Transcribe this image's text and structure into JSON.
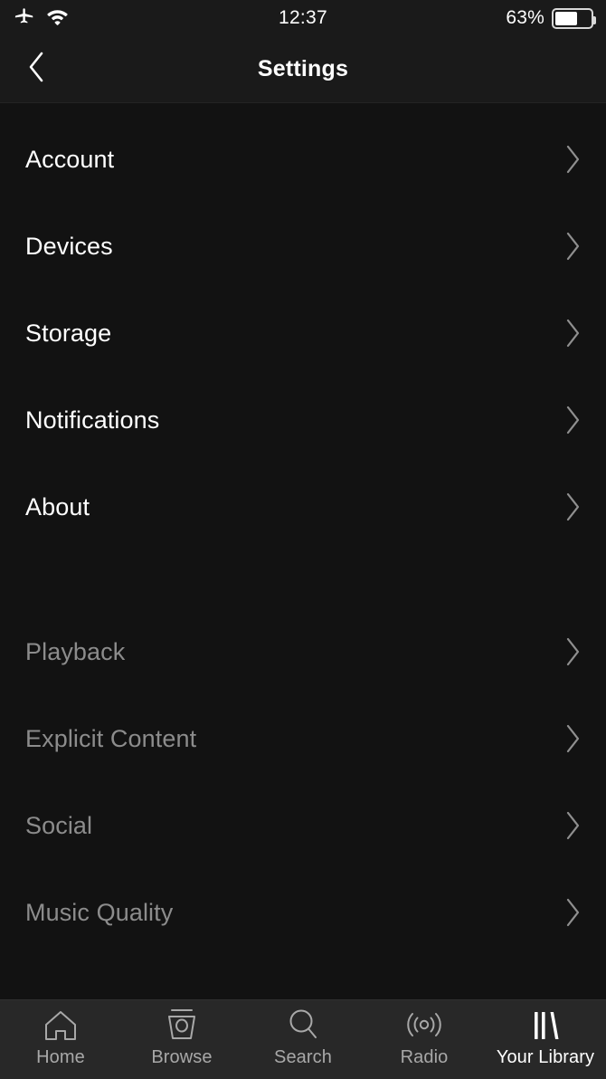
{
  "status_bar": {
    "airplane_icon": "airplane-icon",
    "wifi_icon": "wifi-icon",
    "time": "12:37",
    "battery_text": "63%",
    "battery_percent": 63,
    "battery_icon": "battery-icon"
  },
  "header": {
    "back_icon": "chevron-left-icon",
    "title": "Settings"
  },
  "colors": {
    "screen_bg": "#121212",
    "header_bg": "#1a1a1a",
    "tabbar_bg": "#282828",
    "primary_text": "#ffffff",
    "dimmed_text": "#8c8c8c",
    "chevron": "#8f8f8f",
    "tab_inactive": "#a8a8a8",
    "tab_active": "#ffffff"
  },
  "settings_groups": [
    {
      "name": "primary",
      "dimmed": false,
      "items": [
        {
          "label": "Account",
          "chevron_icon": "chevron-right-icon"
        },
        {
          "label": "Devices",
          "chevron_icon": "chevron-right-icon"
        },
        {
          "label": "Storage",
          "chevron_icon": "chevron-right-icon"
        },
        {
          "label": "Notifications",
          "chevron_icon": "chevron-right-icon"
        },
        {
          "label": "About",
          "chevron_icon": "chevron-right-icon"
        }
      ]
    },
    {
      "name": "secondary",
      "dimmed": true,
      "items": [
        {
          "label": "Playback",
          "chevron_icon": "chevron-right-icon"
        },
        {
          "label": "Explicit Content",
          "chevron_icon": "chevron-right-icon"
        },
        {
          "label": "Social",
          "chevron_icon": "chevron-right-icon"
        },
        {
          "label": "Music Quality",
          "chevron_icon": "chevron-right-icon"
        }
      ]
    }
  ],
  "tabbar": {
    "tabs": [
      {
        "label": "Home",
        "icon": "home-icon",
        "active": false
      },
      {
        "label": "Browse",
        "icon": "browse-icon",
        "active": false
      },
      {
        "label": "Search",
        "icon": "search-icon",
        "active": false
      },
      {
        "label": "Radio",
        "icon": "radio-icon",
        "active": false
      },
      {
        "label": "Your Library",
        "icon": "library-icon",
        "active": true
      }
    ]
  }
}
